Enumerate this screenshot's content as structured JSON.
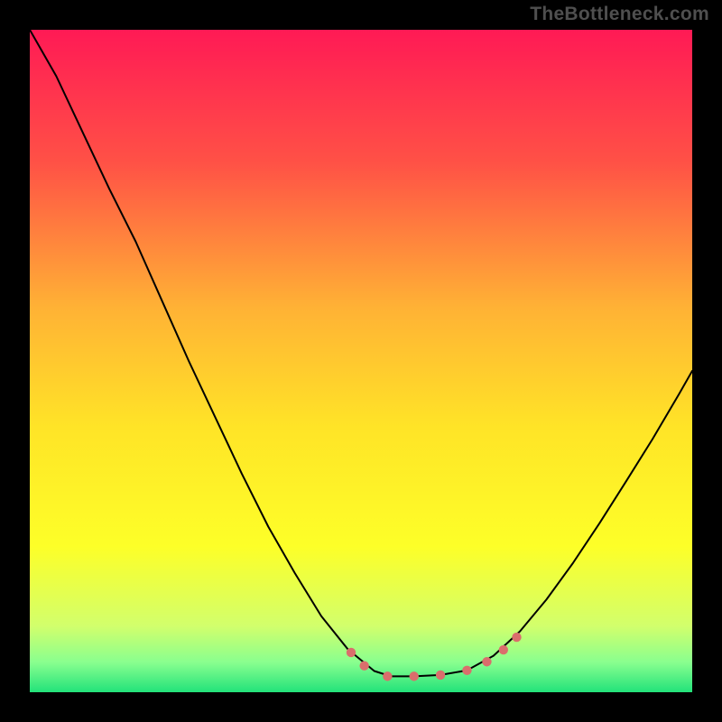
{
  "watermark": "TheBottleneck.com",
  "chart_data": {
    "type": "line",
    "title": "",
    "xlabel": "",
    "ylabel": "",
    "xlim": [
      0,
      100
    ],
    "ylim": [
      0,
      100
    ],
    "grid": false,
    "background_gradient": [
      {
        "offset": 0.0,
        "color": "#ff1a55"
      },
      {
        "offset": 0.2,
        "color": "#ff5146"
      },
      {
        "offset": 0.42,
        "color": "#ffb235"
      },
      {
        "offset": 0.6,
        "color": "#ffe427"
      },
      {
        "offset": 0.78,
        "color": "#fdff28"
      },
      {
        "offset": 0.9,
        "color": "#d2ff6c"
      },
      {
        "offset": 0.955,
        "color": "#89ff8f"
      },
      {
        "offset": 1.0,
        "color": "#22e27a"
      }
    ],
    "series": [
      {
        "name": "bottleneck-curve",
        "x": [
          0,
          4,
          8,
          12,
          16,
          20,
          24,
          28,
          32,
          36,
          40,
          44,
          48,
          52,
          54.5,
          58,
          62,
          66,
          70,
          74,
          78,
          82,
          86,
          90,
          94,
          98,
          100
        ],
        "y": [
          100,
          93,
          84.5,
          76,
          68,
          59,
          50,
          41.5,
          33,
          25,
          18,
          11.5,
          6.5,
          3.2,
          2.4,
          2.4,
          2.6,
          3.3,
          5.5,
          9.2,
          14,
          19.5,
          25.5,
          31.8,
          38.2,
          45,
          48.5
        ]
      }
    ],
    "markers": {
      "color": "#da6e6c",
      "points_x": [
        48.5,
        50.5,
        54,
        58,
        62,
        66,
        69,
        71.5,
        73.5
      ],
      "points_y": [
        6.0,
        4.0,
        2.4,
        2.4,
        2.6,
        3.3,
        4.6,
        6.4,
        8.3
      ]
    }
  }
}
